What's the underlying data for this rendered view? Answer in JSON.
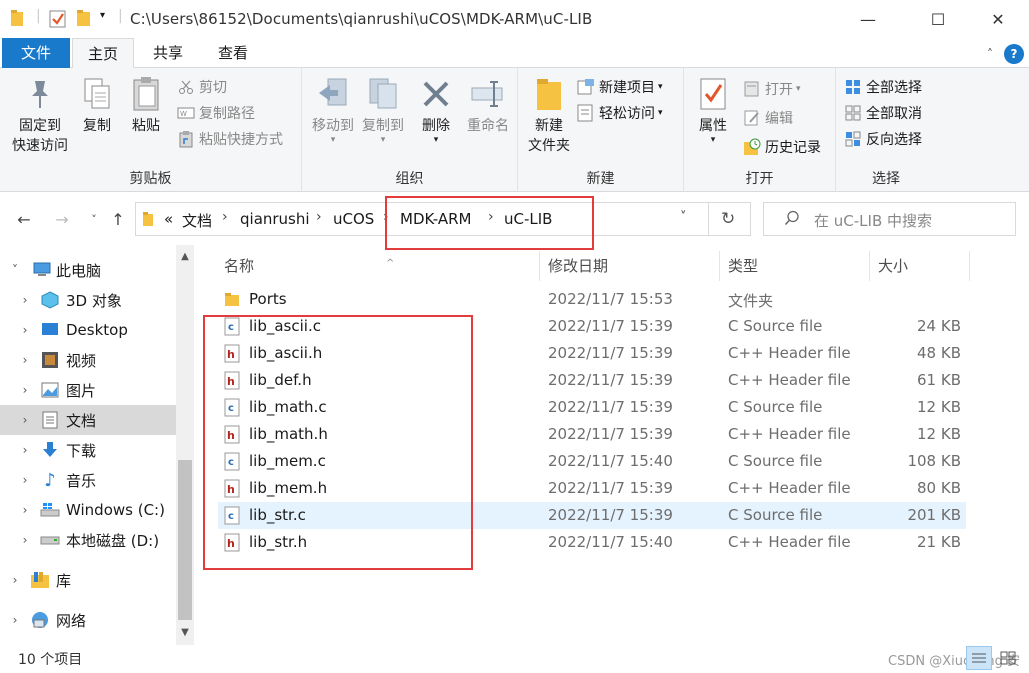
{
  "titlebar": {
    "path": "C:\\Users\\86152\\Documents\\qianrushi\\uCOS\\MDK-ARM\\uC-LIB",
    "minimize": "—",
    "maximize": "☐",
    "close": "✕"
  },
  "tabs": {
    "file": "文件",
    "home": "主页",
    "share": "共享",
    "view": "查看"
  },
  "ribbon": {
    "clipboard": {
      "label": "剪贴板",
      "pin_quick_access": [
        "固定到",
        "快速访问"
      ],
      "copy": "复制",
      "paste": "粘贴",
      "cut": "剪切",
      "copy_path": "复制路径",
      "paste_shortcut": "粘贴快捷方式"
    },
    "organize": {
      "label": "组织",
      "move_to": "移动到",
      "copy_to": "复制到",
      "delete": "删除",
      "rename": "重命名"
    },
    "new": {
      "label": "新建",
      "new_folder": [
        "新建",
        "文件夹"
      ],
      "new_item": "新建项目",
      "easy_access": "轻松访问"
    },
    "open": {
      "label": "打开",
      "properties": "属性",
      "open": "打开",
      "edit": "编辑",
      "history": "历史记录"
    },
    "select": {
      "label": "选择",
      "select_all": "全部选择",
      "select_none": "全部取消",
      "invert": "反向选择"
    }
  },
  "address": {
    "overflow": "«",
    "crumbs": [
      "文档",
      "qianrushi",
      "uCOS",
      "MDK-ARM",
      "uC-LIB"
    ],
    "search_placeholder": "在 uC-LIB 中搜索"
  },
  "sidebar": {
    "items": [
      {
        "label": "此电脑",
        "icon": "computer-icon"
      },
      {
        "label": "3D 对象",
        "icon": "3d-objects-icon"
      },
      {
        "label": "Desktop",
        "icon": "desktop-icon"
      },
      {
        "label": "视频",
        "icon": "videos-icon"
      },
      {
        "label": "图片",
        "icon": "pictures-icon"
      },
      {
        "label": "文档",
        "icon": "documents-icon"
      },
      {
        "label": "下载",
        "icon": "downloads-icon"
      },
      {
        "label": "音乐",
        "icon": "music-icon"
      },
      {
        "label": "Windows (C:)",
        "icon": "windows-drive-icon"
      },
      {
        "label": "本地磁盘 (D:)",
        "icon": "local-disk-icon"
      },
      {
        "label": "库",
        "icon": "library-icon"
      },
      {
        "label": "网络",
        "icon": "network-icon"
      }
    ]
  },
  "columns": {
    "name": "名称",
    "modified": "修改日期",
    "type": "类型",
    "size": "大小"
  },
  "files": [
    {
      "name": "Ports",
      "date": "2022/11/7 15:53",
      "type": "文件夹",
      "size": "",
      "kind": "folder"
    },
    {
      "name": "lib_ascii.c",
      "date": "2022/11/7 15:39",
      "type": "C Source file",
      "size": "24 KB",
      "kind": "c"
    },
    {
      "name": "lib_ascii.h",
      "date": "2022/11/7 15:39",
      "type": "C++ Header file",
      "size": "48 KB",
      "kind": "h"
    },
    {
      "name": "lib_def.h",
      "date": "2022/11/7 15:39",
      "type": "C++ Header file",
      "size": "61 KB",
      "kind": "h"
    },
    {
      "name": "lib_math.c",
      "date": "2022/11/7 15:39",
      "type": "C Source file",
      "size": "12 KB",
      "kind": "c"
    },
    {
      "name": "lib_math.h",
      "date": "2022/11/7 15:39",
      "type": "C++ Header file",
      "size": "12 KB",
      "kind": "h"
    },
    {
      "name": "lib_mem.c",
      "date": "2022/11/7 15:40",
      "type": "C Source file",
      "size": "108 KB",
      "kind": "c"
    },
    {
      "name": "lib_mem.h",
      "date": "2022/11/7 15:39",
      "type": "C++ Header file",
      "size": "80 KB",
      "kind": "h"
    },
    {
      "name": "lib_str.c",
      "date": "2022/11/7 15:39",
      "type": "C Source file",
      "size": "201 KB",
      "kind": "c"
    },
    {
      "name": "lib_str.h",
      "date": "2022/11/7 15:40",
      "type": "C++ Header file",
      "size": "21 KB",
      "kind": "h"
    }
  ],
  "status": {
    "count": "10 个项目",
    "watermark": "CSDN @Xiucheng 安"
  },
  "colors": {
    "accent": "#1979ca",
    "highlight_box": "#e23c3c",
    "hover_row": "#e5f3ff",
    "folder": "#f5c242"
  }
}
